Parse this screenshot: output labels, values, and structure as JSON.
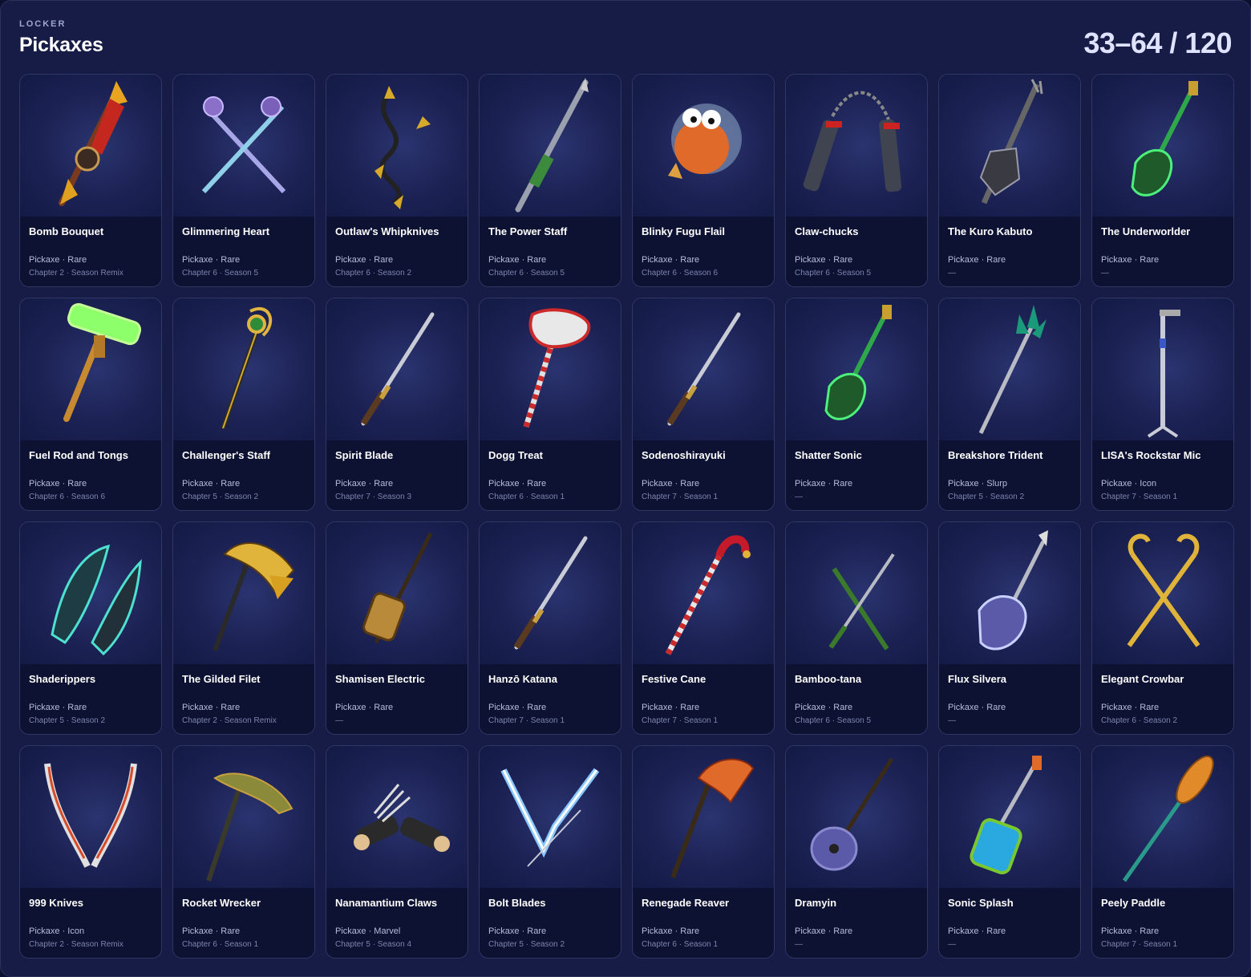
{
  "header": {
    "eyebrow": "LOCKER",
    "title": "Pickaxes",
    "counter": "33–64 / 120"
  },
  "items": [
    {
      "name": "Bomb Bouquet",
      "type": "Pickaxe · Rare",
      "chapter": "Chapter 2 · Season Remix",
      "icon": "rocket-bouquet-icon"
    },
    {
      "name": "Glimmering Heart",
      "type": "Pickaxe · Rare",
      "chapter": "Chapter 6 · Season 5",
      "icon": "crossed-maces-icon"
    },
    {
      "name": "Outlaw's Whipknives",
      "type": "Pickaxe · Rare",
      "chapter": "Chapter 6 · Season 2",
      "icon": "whip-knives-icon"
    },
    {
      "name": "The Power Staff",
      "type": "Pickaxe · Rare",
      "chapter": "Chapter 6 · Season 5",
      "icon": "staff-icon"
    },
    {
      "name": "Blinky Fugu Flail",
      "type": "Pickaxe · Rare",
      "chapter": "Chapter 6 · Season 6",
      "icon": "pufferfish-icon"
    },
    {
      "name": "Claw-chucks",
      "type": "Pickaxe · Rare",
      "chapter": "Chapter 6 · Season 5",
      "icon": "nunchucks-icon"
    },
    {
      "name": "The Kuro Kabuto",
      "type": "Pickaxe · Rare",
      "chapter": "—",
      "icon": "guitar-icon"
    },
    {
      "name": "The Underworlder",
      "type": "Pickaxe · Rare",
      "chapter": "—",
      "icon": "green-guitar-icon"
    },
    {
      "name": "Fuel Rod and Tongs",
      "type": "Pickaxe · Rare",
      "chapter": "Chapter 6 · Season 6",
      "icon": "fuel-rod-icon"
    },
    {
      "name": "Challenger's Staff",
      "type": "Pickaxe · Rare",
      "chapter": "Chapter 5 · Season 2",
      "icon": "gold-staff-icon"
    },
    {
      "name": "Spirit Blade",
      "type": "Pickaxe · Rare",
      "chapter": "Chapter 7 · Season 3",
      "icon": "katana-icon"
    },
    {
      "name": "Dogg Treat",
      "type": "Pickaxe · Rare",
      "chapter": "Chapter 6 · Season 1",
      "icon": "bone-hammer-icon"
    },
    {
      "name": "Sodenoshirayuki",
      "type": "Pickaxe · Rare",
      "chapter": "Chapter 7 · Season 1",
      "icon": "katana-icon"
    },
    {
      "name": "Shatter Sonic",
      "type": "Pickaxe · Rare",
      "chapter": "—",
      "icon": "green-guitar-icon"
    },
    {
      "name": "Breakshore Trident",
      "type": "Pickaxe · Slurp",
      "chapter": "Chapter 5 · Season 2",
      "icon": "trident-icon"
    },
    {
      "name": "LISA's Rockstar Mic",
      "type": "Pickaxe · Icon",
      "chapter": "Chapter 7 · Season 1",
      "icon": "mic-stand-icon"
    },
    {
      "name": "Shaderippers",
      "type": "Pickaxe · Rare",
      "chapter": "Chapter 5 · Season 2",
      "icon": "dragon-blades-icon"
    },
    {
      "name": "The Gilded Filet",
      "type": "Pickaxe · Rare",
      "chapter": "Chapter 2 · Season Remix",
      "icon": "fish-bone-axe-icon"
    },
    {
      "name": "Shamisen Electric",
      "type": "Pickaxe · Rare",
      "chapter": "—",
      "icon": "shamisen-icon"
    },
    {
      "name": "Hanzō Katana",
      "type": "Pickaxe · Rare",
      "chapter": "Chapter 7 · Season 1",
      "icon": "katana-icon"
    },
    {
      "name": "Festive Cane",
      "type": "Pickaxe · Rare",
      "chapter": "Chapter 7 · Season 1",
      "icon": "candy-cane-icon"
    },
    {
      "name": "Bamboo-tana",
      "type": "Pickaxe · Rare",
      "chapter": "Chapter 6 · Season 5",
      "icon": "crossed-swords-icon"
    },
    {
      "name": "Flux Silvera",
      "type": "Pickaxe · Rare",
      "chapter": "—",
      "icon": "chrome-guitar-icon"
    },
    {
      "name": "Elegant Crowbar",
      "type": "Pickaxe · Rare",
      "chapter": "Chapter 6 · Season 2",
      "icon": "crowbars-icon"
    },
    {
      "name": "999 Knives",
      "type": "Pickaxe · Icon",
      "chapter": "Chapter 2 · Season Remix",
      "icon": "curved-knives-icon"
    },
    {
      "name": "Rocket Wrecker",
      "type": "Pickaxe · Rare",
      "chapter": "Chapter 6 · Season 1",
      "icon": "rocket-axe-icon"
    },
    {
      "name": "Nanamantium Claws",
      "type": "Pickaxe · Marvel",
      "chapter": "Chapter 5 · Season 4",
      "icon": "claws-icon"
    },
    {
      "name": "Bolt Blades",
      "type": "Pickaxe · Rare",
      "chapter": "Chapter 5 · Season 2",
      "icon": "lightning-blades-icon"
    },
    {
      "name": "Renegade Reaver",
      "type": "Pickaxe · Rare",
      "chapter": "Chapter 6 · Season 1",
      "icon": "axe-icon"
    },
    {
      "name": "Dramyin",
      "type": "Pickaxe · Rare",
      "chapter": "—",
      "icon": "lute-icon"
    },
    {
      "name": "Sonic Splash",
      "type": "Pickaxe · Rare",
      "chapter": "—",
      "icon": "water-gun-guitar-icon"
    },
    {
      "name": "Peely Paddle",
      "type": "Pickaxe · Rare",
      "chapter": "Chapter 7 · Season 1",
      "icon": "paddle-icon"
    }
  ]
}
